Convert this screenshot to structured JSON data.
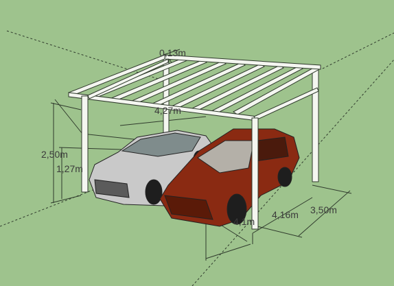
{
  "scene": {
    "background_color": "#9ec38d",
    "line_color": "#2f3a2c",
    "post_fill": "#f4f6f0",
    "car_white_fill": "#c9c9c9",
    "car_red_fill": "#8a2a12"
  },
  "dimensions": {
    "beam_spacing": "0,13m",
    "upper_span": "4,27m",
    "height": "2,50m",
    "car_height": "1,27m",
    "depth": "4,16m",
    "width": "3,50m",
    "lower_span": "4,1m"
  }
}
